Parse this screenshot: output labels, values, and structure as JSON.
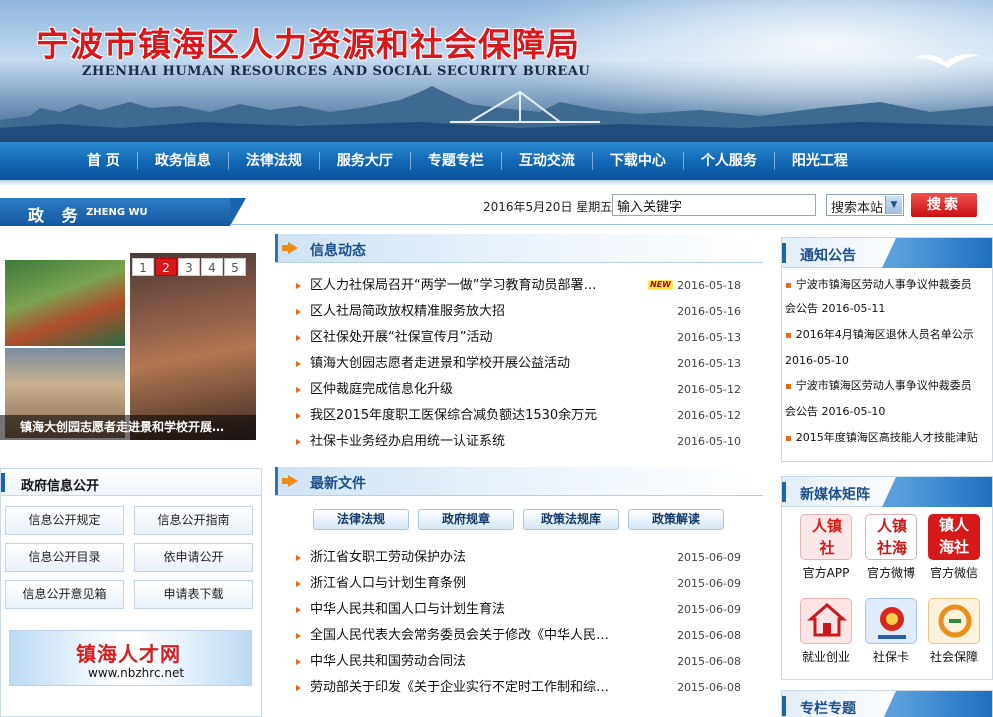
{
  "header": {
    "title_cn": "宁波市镇海区人力资源和社会保障局",
    "title_en": "ZHENHAI HUMAN RESOURCES AND SOCIAL SECURITY BUREAU"
  },
  "nav": [
    "首 页",
    "政务信息",
    "法律法规",
    "服务大厅",
    "专题专栏",
    "互动交流",
    "下载中心",
    "个人服务",
    "阳光工程"
  ],
  "section": {
    "cn": "政 务",
    "en": "ZHENG WU"
  },
  "toolbar": {
    "date": "2016年5月20日  星期五",
    "search_value": "输入关键字",
    "scope": "搜索本站",
    "search_label": "搜索"
  },
  "slideshow": {
    "pages": [
      "1",
      "2",
      "3",
      "4",
      "5"
    ],
    "active_page": "2",
    "caption": "镇海大创园志愿者走进景和学校开展…"
  },
  "gov_info": {
    "title": "政府信息公开",
    "buttons": [
      "信息公开规定",
      "信息公开指南",
      "信息公开目录",
      "依申请公开",
      "信息公开意见箱",
      "申请表下载"
    ],
    "talent_banner": {
      "title": "镇海人才网",
      "url": "www.nbzhrc.net"
    }
  },
  "news": {
    "title": "信息动态",
    "new_badge": "NEW",
    "items": [
      {
        "title": "区人力社保局召开“两学一做”学习教育动员部署…",
        "date": "2016-05-18",
        "new": true
      },
      {
        "title": "区人社局简政放权精准服务放大招",
        "date": "2016-05-16"
      },
      {
        "title": "区社保处开展“社保宣传月”活动",
        "date": "2016-05-13"
      },
      {
        "title": "镇海大创园志愿者走进景和学校开展公益活动",
        "date": "2016-05-13"
      },
      {
        "title": "区仲裁庭完成信息化升级",
        "date": "2016-05-12"
      },
      {
        "title": "我区2015年度职工医保综合减负额达1530余万元",
        "date": "2016-05-12"
      },
      {
        "title": "社保卡业务经办启用统一认证系统",
        "date": "2016-05-10"
      }
    ]
  },
  "files": {
    "title": "最新文件",
    "tabs": [
      "法律法规",
      "政府规章",
      "政策法规库",
      "政策解读"
    ],
    "items": [
      {
        "title": "浙江省女职工劳动保护办法",
        "date": "2015-06-09"
      },
      {
        "title": "浙江省人口与计划生育条例",
        "date": "2015-06-09"
      },
      {
        "title": "中华人民共和国人口与计划生育法",
        "date": "2015-06-09"
      },
      {
        "title": "全国人民代表大会常务委员会关于修改《中华人民…",
        "date": "2015-06-08"
      },
      {
        "title": "中华人民共和国劳动合同法",
        "date": "2015-06-08"
      },
      {
        "title": "劳动部关于印发《关于企业实行不定时工作制和综…",
        "date": "2015-06-08"
      }
    ]
  },
  "notices": {
    "title": "通知公告",
    "lines": [
      {
        "text": "宁波市镇海区劳动人事争议仲裁委员",
        "bullet": true
      },
      {
        "text": "会公告  2016-05-11",
        "bullet": false
      },
      {
        "text": "2016年4月镇海区退休人员名单公示",
        "bullet": true
      },
      {
        "text": "2016-05-10",
        "bullet": false
      },
      {
        "text": "宁波市镇海区劳动人事争议仲裁委员",
        "bullet": true
      },
      {
        "text": "会公告  2016-05-10",
        "bullet": false
      },
      {
        "text": "2015年度镇海区高技能人才技能津贴",
        "bullet": true
      }
    ]
  },
  "media": {
    "title": "新媒体矩阵",
    "items": [
      {
        "label": "官方APP",
        "glyph": "人镇\n社",
        "color": "#d61a1a",
        "bg": "#fbe7e7",
        "icon": "app-icon"
      },
      {
        "label": "官方微博",
        "glyph": "人镇\n社海",
        "color": "#c81a1a",
        "bg": "#fff",
        "icon": "weibo-icon"
      },
      {
        "label": "官方微信",
        "glyph": "镇人\n海社",
        "color": "#fff",
        "bg": "#d61a1a",
        "icon": "wechat-icon"
      },
      {
        "label": "就业创业",
        "glyph": "",
        "color": "#c81a1a",
        "bg": "#fde5e5",
        "icon": "employment-icon"
      },
      {
        "label": "社保卡",
        "glyph": "",
        "color": "#2a5fa8",
        "bg": "#e1ecfa",
        "icon": "social-card-icon"
      },
      {
        "label": "社会保障",
        "glyph": "",
        "color": "#e8901a",
        "bg": "#fff2dc",
        "icon": "social-security-icon"
      }
    ]
  },
  "special": {
    "title": "专栏专题"
  }
}
